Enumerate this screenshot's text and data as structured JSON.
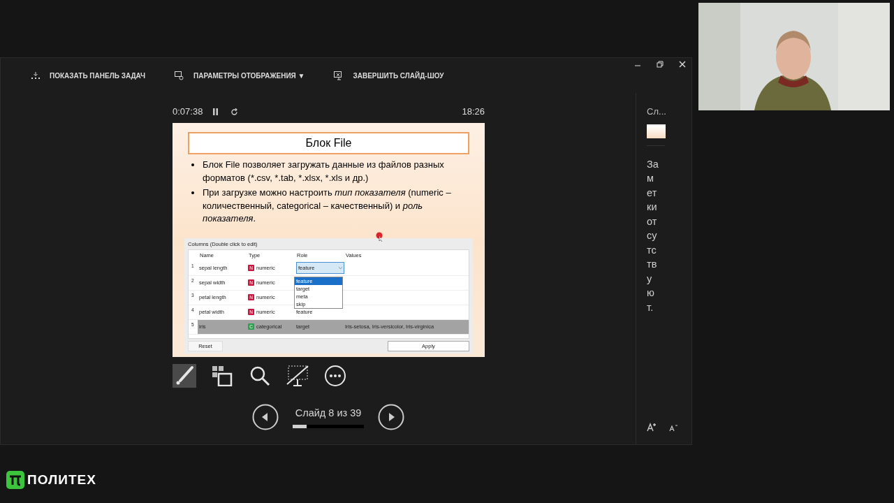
{
  "toolbar": {
    "items": [
      {
        "kind": "taskbar",
        "label": "ПОКАЗАТЬ ПАНЕЛЬ ЗАДАЧ"
      },
      {
        "kind": "display",
        "label": "ПАРАМЕТРЫ ОТОБРАЖЕНИЯ ▼"
      },
      {
        "kind": "end",
        "label": "ЗАВЕРШИТЬ СЛАЙД-ШОУ"
      }
    ]
  },
  "timer": {
    "elapsed": "0:07:38",
    "clock": "18:26"
  },
  "slide": {
    "title": "Блок File",
    "bullets": [
      "Блок File позволяет загружать данные из файлов разных форматов (*.csv, *.tab, *.xlsx, *.xls и др.)",
      "При загрузке можно настроить *тип показателя* (numeric – количественный, categorical – качественный) и *роль показателя*."
    ],
    "dialog": {
      "caption": "Columns (Double click to edit)",
      "columns": [
        "Name",
        "Type",
        "Role",
        "Values"
      ],
      "rows": [
        {
          "index": "1",
          "name": "sepal length",
          "badge": "N",
          "color": "#c8163e",
          "type": "numeric",
          "role": "feature",
          "kind": "combo",
          "values": null,
          "selected": false
        },
        {
          "index": "2",
          "name": "sepal width",
          "badge": "N",
          "color": "#c8163e",
          "type": "numeric",
          "values": null,
          "selected": false
        },
        {
          "index": "3",
          "name": "petal length",
          "badge": "N",
          "color": "#c8163e",
          "type": "numeric",
          "values": null,
          "selected": false
        },
        {
          "index": "4",
          "name": "petal width",
          "badge": "N",
          "color": "#c8163e",
          "type": "numeric",
          "role": "feature",
          "kind": "text",
          "values": null,
          "selected": false
        },
        {
          "index": "5",
          "name": "iris",
          "badge": "C",
          "color": "#2e9e4f",
          "type": "categorical",
          "role": "target",
          "kind": "text",
          "values": "Iris-setosa, Iris-versicolor, Iris-virginica",
          "selected": true
        }
      ],
      "dropdown": [
        {
          "label": "feature",
          "selected": true
        },
        {
          "label": "target",
          "selected": false
        },
        {
          "label": "meta",
          "selected": false
        },
        {
          "label": "skip",
          "selected": false
        }
      ],
      "buttons": [
        "Reset",
        "Apply"
      ]
    }
  },
  "tools": [
    {
      "kind": "pen",
      "selected": true
    },
    {
      "kind": "slides",
      "selected": false
    },
    {
      "kind": "zoom",
      "selected": false
    },
    {
      "kind": "black",
      "selected": false
    },
    {
      "kind": "more",
      "selected": false
    }
  ],
  "navigation": {
    "label": "Слайд 8 из 39",
    "level": 0.2
  },
  "notes_pane": {
    "header": "Сл...",
    "text": "Заметки отсутствуют."
  },
  "logo": {
    "text": "ПОЛИТЕХ"
  }
}
